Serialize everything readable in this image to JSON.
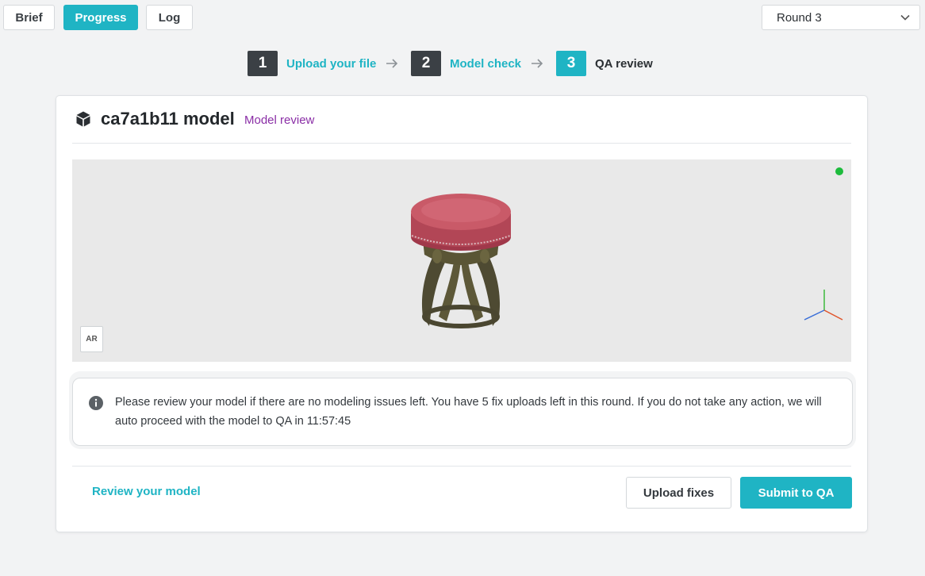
{
  "tabs": [
    {
      "label": "Brief",
      "active": false
    },
    {
      "label": "Progress",
      "active": true
    },
    {
      "label": "Log",
      "active": false
    }
  ],
  "round_select": {
    "value": "Round 3"
  },
  "steps": [
    {
      "number": "1",
      "label": "Upload your file",
      "state": "done"
    },
    {
      "number": "2",
      "label": "Model check",
      "state": "done"
    },
    {
      "number": "3",
      "label": "QA review",
      "state": "current"
    }
  ],
  "card": {
    "title": "ca7a1b11 model",
    "tag": "Model review"
  },
  "viewer": {
    "ar_label": "AR",
    "status_color": "#1dbb3c"
  },
  "notice": {
    "text": "Please review your model if there are no modeling issues left. You have 5 fix uploads left in this round. If you do not take any action, we will auto proceed with the model to QA in 11:57:45"
  },
  "footer": {
    "review_link": "Review your model",
    "upload_button": "Upload fixes",
    "submit_button": "Submit to QA"
  },
  "colors": {
    "accent": "#1fb4c4",
    "tag": "#8a2ea6",
    "step_done": "#3b4045"
  }
}
